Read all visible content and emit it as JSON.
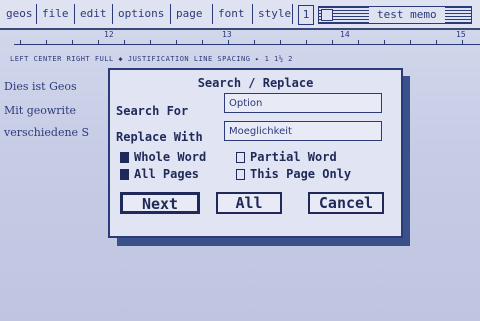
{
  "menubar": {
    "items": [
      "geos",
      "file",
      "edit",
      "options",
      "page",
      "font",
      "style"
    ],
    "page_number": "1",
    "window_title": "test memo"
  },
  "ruler": {
    "numbers": [
      "12",
      "13",
      "14",
      "15"
    ],
    "buttons_text": "LEFT  CENTER  RIGHT  FULL  ◆  JUSTIFICATION  LINE SPACING ▸  1  1½  2"
  },
  "document": {
    "lines": [
      "Dies ist Geos",
      "Mit geowrite",
      "verschiedene S"
    ]
  },
  "dialog": {
    "title": "Search / Replace",
    "search_label": "Search For",
    "search_value": "Option",
    "replace_label": "Replace With",
    "replace_value": "Moeglichkeit",
    "options": {
      "whole_word": "Whole Word",
      "partial_word": "Partial Word",
      "all_pages": "All Pages",
      "this_page_only": "This Page Only"
    },
    "buttons": {
      "next": "Next",
      "all": "All",
      "cancel": "Cancel"
    }
  }
}
